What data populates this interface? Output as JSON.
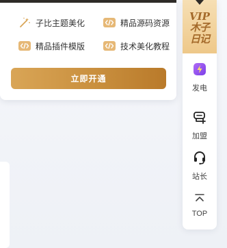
{
  "vip_panel": {
    "features": [
      {
        "label": "子比主题美化",
        "icon": "magic-wand-icon"
      },
      {
        "label": "精品源码资源",
        "icon": "code-tag-icon"
      },
      {
        "label": "精品插件模版",
        "icon": "code-tag-icon"
      },
      {
        "label": "技术美化教程",
        "icon": "code-tag-icon"
      }
    ],
    "open_button_label": "立即开通"
  },
  "sidebar": {
    "vip_badge": {
      "word": "VIP",
      "brand_line1": "木子",
      "brand_line2": "日记"
    },
    "items": [
      {
        "label": "发电",
        "icon": "charge-battery-icon"
      },
      {
        "label": "加盟",
        "icon": "join-chat-icon"
      },
      {
        "label": "站长",
        "icon": "headset-icon"
      },
      {
        "label": "TOP",
        "icon": "back-to-top-icon"
      }
    ]
  },
  "colors": {
    "gold_start": "#d9a556",
    "gold_end": "#b97a2a",
    "badge_bg": "#eec889",
    "charge_purple": "#9b59f0",
    "dark_bar": "#2e2b27"
  }
}
